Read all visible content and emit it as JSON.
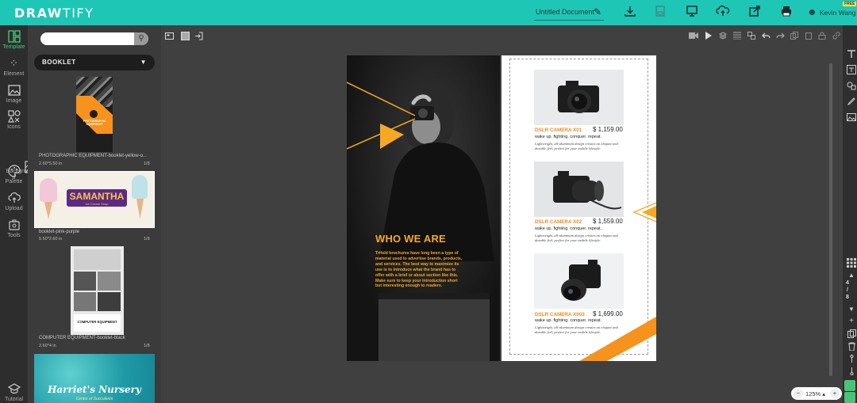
{
  "app": {
    "logo_bold": "DRAW",
    "logo_thin": "TIFY",
    "doc_title": "Untitled Document",
    "user_name": "Kevin Wang",
    "free_badge": "FREE"
  },
  "left_rail": [
    {
      "label": "Template",
      "icon": "template-icon"
    },
    {
      "label": "Element",
      "icon": "element-icon"
    },
    {
      "label": "Image",
      "icon": "image-icon"
    },
    {
      "label": "Icons",
      "icon": "icons-icon"
    },
    {
      "label": "Backgroun\nd",
      "icon": "background-icon"
    },
    {
      "label": "Palette",
      "icon": "palette-icon"
    },
    {
      "label": "Upload",
      "icon": "upload-icon"
    },
    {
      "label": "Tools",
      "icon": "tools-icon"
    },
    {
      "label": "Tutorial",
      "icon": "tutorial-icon"
    }
  ],
  "panel": {
    "search_placeholder": "",
    "category": "BOOKLET",
    "templates": [
      {
        "title": "PHOTOGRAPHIC EQUIPMENT-booklet-yellow-o...",
        "size": "2.60*5.50 in",
        "pages": "1/8",
        "thumb_text": "PHOTOGRAPHIC EQUIPMENT"
      },
      {
        "title": "booklet-pink-purple",
        "size": "5.50*2.60 in",
        "pages": "1/8",
        "thumb_text": "SAMANTHA",
        "thumb_sub": "Ice Cream Shop"
      },
      {
        "title": "COMPUTER EQUIPMENT-booklet-black",
        "size": "2.60*4 in",
        "pages": "1/8",
        "thumb_text": "COMPUTER EQUIPMENT"
      },
      {
        "title": "",
        "size": "",
        "pages": "",
        "thumb_text": "Harriet's Nursery",
        "thumb_sub": "Center of Succulents"
      }
    ]
  },
  "document": {
    "left": {
      "heading": "WHO WE ARE",
      "body": "Trifold brochures have long been a type of material used to advertise brands, products, and services. The best way to maximize its use is to introduce what the brand has to offer with a brief or about section like this. Make sure to keep your introduction short but interesting enough to readers."
    },
    "products": [
      {
        "name": "DSLR CAMERA X01",
        "price": "$ 1,159.00",
        "tagline": "wake up. fighting. conquer. repeat.",
        "desc": "Lightweight, all-aluminum design creates an elegant and durable feel, perfect for your mobile lifestyle."
      },
      {
        "name": "DSLR CAMERA X02",
        "price": "$ 1,559.00",
        "tagline": "wake up. fighting. conquer. repeat.",
        "desc": "Lightweight, all-aluminum design creates an elegant and durable feel, perfect for your mobile lifestyle."
      },
      {
        "name": "DSLR CAMERA X003",
        "price": "$ 1,699.00",
        "tagline": "wake up. fighting. conquer. repeat.",
        "desc": "Lightweight, all-aluminum design creates an elegant and durable feel, perfect for your mobile lifestyle."
      }
    ]
  },
  "pager": {
    "current": "4",
    "sep": "/",
    "total": "8"
  },
  "zoom": {
    "value": "125%",
    "minus": "−",
    "plus": "+"
  },
  "colors": {
    "accent": "#1ec6b6",
    "brand_orange": "#f7a823",
    "active_green": "#46c478"
  }
}
